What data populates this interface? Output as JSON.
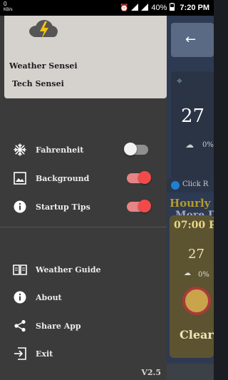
{
  "status_bar": {
    "left_top": "0",
    "left_unit": "KB/s",
    "battery": "40%",
    "time": "7:20 PM"
  },
  "drawer": {
    "header": {
      "app_name": "Weather Sensei",
      "developer": "Tech Sensei",
      "logo_icon": "storm-cloud-icon"
    },
    "settings": [
      {
        "label": "Fahrenheit",
        "icon": "snowflake-icon",
        "enabled": false
      },
      {
        "label": "Background",
        "icon": "image-icon",
        "enabled": true
      },
      {
        "label": "Startup Tips",
        "icon": "info-icon",
        "enabled": true
      }
    ],
    "menu": [
      {
        "label": "Weather Guide",
        "icon": "book-icon"
      },
      {
        "label": "About",
        "icon": "info-icon"
      },
      {
        "label": "Share App",
        "icon": "share-icon"
      },
      {
        "label": "Exit",
        "icon": "exit-icon"
      }
    ],
    "version": "V2.5",
    "colors": {
      "toggle_on": "#f24a4a",
      "toggle_off": "#f2f2f2",
      "drawer_bg": "#3b3b3b",
      "header_bg": "#d5d1cd"
    }
  },
  "background_app": {
    "back_icon": "arrow-left-icon",
    "temp": "27",
    "precip": "0%",
    "more": "More D",
    "tip": "Click R",
    "hourly": "Hourly",
    "hour_time": "07:00 P",
    "hour_temp": "27",
    "hour_precip": "0%",
    "hour_condition": "Clear"
  }
}
